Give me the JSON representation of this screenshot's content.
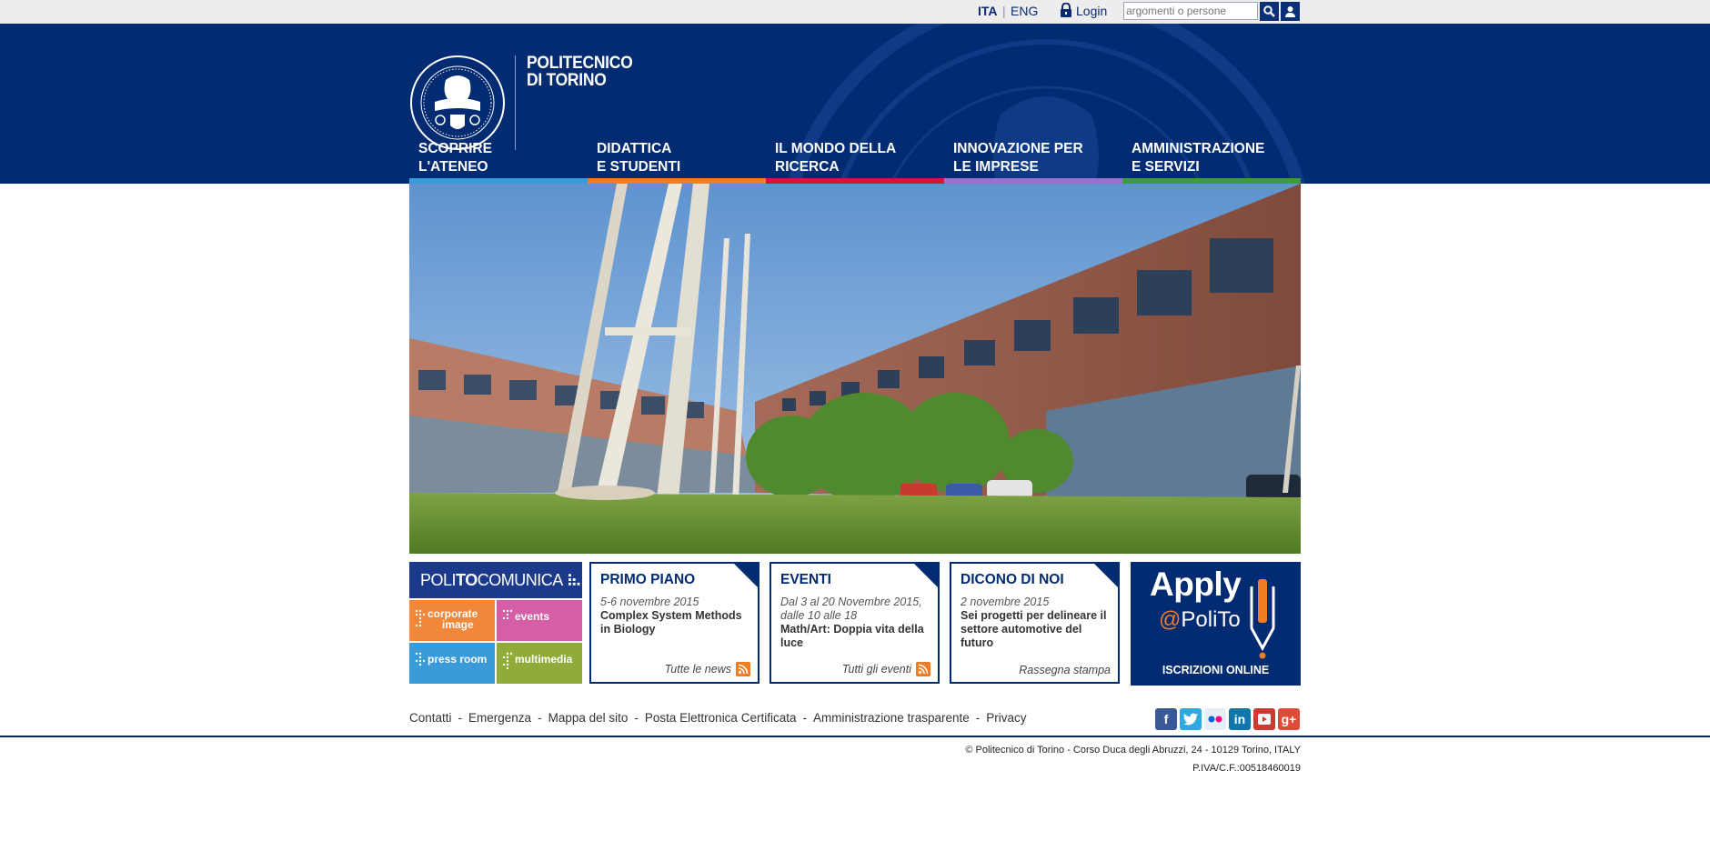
{
  "topbar": {
    "lang_ita": "ITA",
    "lang_sep": "|",
    "lang_eng": "ENG",
    "login": "Login",
    "search_placeholder": "argomenti o persone"
  },
  "brand": {
    "line1": "POLITECNICO",
    "line2": "DI TORINO"
  },
  "nav": [
    {
      "line1": "SCOPRIRE",
      "line2": "L'ATENEO",
      "color": "#3a9bd8"
    },
    {
      "line1": "DIDATTICA",
      "line2": "E STUDENTI",
      "color": "#f07c23"
    },
    {
      "line1": "IL MONDO DELLA",
      "line2": "RICERCA",
      "color": "#d7143f"
    },
    {
      "line1": "INNOVAZIONE PER",
      "line2": "LE IMPRESE",
      "color": "#9b6fcf"
    },
    {
      "line1": "AMMINISTRAZIONE",
      "line2": "E SERVIZI",
      "color": "#3f9b3f"
    }
  ],
  "politocomunica": {
    "title_pre": "POLI",
    "title_bold": "TO",
    "title_post": "COMUNICA",
    "tiles": {
      "corporate": "corporate",
      "corporate2": "image",
      "events": "events",
      "press": "press room",
      "multimedia": "multimedia"
    }
  },
  "news": [
    {
      "heading": "PRIMO PIANO",
      "date": "5-6 novembre 2015",
      "title": "Complex System Methods in Biology",
      "more": "Tutte le news"
    },
    {
      "heading": "EVENTI",
      "date": "Dal 3 al 20 Novembre 2015, dalle 10 alle 18",
      "title": "Math/Art: Doppia vita della luce",
      "more": "Tutti gli eventi"
    },
    {
      "heading": "DICONO DI NOI",
      "date": "2 novembre 2015",
      "title": "Sei progetti per delineare il settore automotive del futuro",
      "more": "Rassegna stampa"
    }
  ],
  "apply": {
    "big": "Apply",
    "at": "@",
    "polito": "PoliTo",
    "cta": "ISCRIZIONI ONLINE"
  },
  "footer": {
    "links": [
      "Contatti",
      "Emergenza",
      "Mappa del sito",
      "Posta Elettronica Certificata",
      "Amministrazione trasparente",
      "Privacy"
    ],
    "copyright": "© Politecnico di Torino - Corso Duca degli Abruzzi, 24 - 10129 Torino, ITALY",
    "piva": "P.IVA/C.F.:00518460019"
  },
  "colors": {
    "brand_blue": "#032b71",
    "accent_orange": "#f07c23"
  }
}
